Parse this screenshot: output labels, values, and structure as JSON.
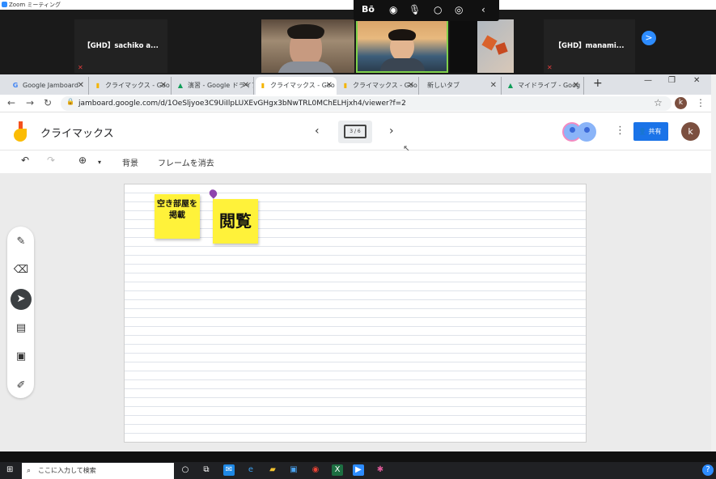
{
  "zoom": {
    "window_title": "Zoom ミーティング",
    "participants": [
      "【GHD】sachiko a...",
      "【GHD】manami..."
    ],
    "toolbar_icons": [
      "bo-logo-icon",
      "record-icon",
      "microphone-icon",
      "circle-icon",
      "audio-wave-icon",
      "chevron-left-icon"
    ],
    "next_label": ">"
  },
  "browser": {
    "tabs": [
      {
        "label": "Google Jamboard",
        "icon": "google-icon"
      },
      {
        "label": "クライマックス - Goo",
        "icon": "jamboard-icon"
      },
      {
        "label": "演習 - Google ドライブ",
        "icon": "drive-icon"
      },
      {
        "label": "クライマックス - Goo",
        "icon": "jamboard-icon",
        "active": true
      },
      {
        "label": "クライマックス - Goo",
        "icon": "jamboard-icon"
      },
      {
        "label": "新しいタブ",
        "icon": ""
      },
      {
        "label": "マイドライブ - Goog",
        "icon": "drive-icon"
      }
    ],
    "new_tab": "+",
    "url": "jamboard.google.com/d/1OeSljyoe3C9UiIlpLUXEvGHgx3bNwTRL0MChELHjxh4/viewer?f=2",
    "profile_initial": "k"
  },
  "jamboard": {
    "title": "クライマックス",
    "frame_indicator": "3 / 6",
    "share_label": "共有",
    "profile_initial": "k",
    "toolbar": {
      "background_label": "背景",
      "clear_frame_label": "フレームを消去"
    },
    "stickies": [
      {
        "text": "空き部屋を掲載",
        "color": "#fff23a"
      },
      {
        "text": "閲覧",
        "color": "#fff23a"
      }
    ],
    "tools": [
      "pen-icon",
      "eraser-icon",
      "select-icon",
      "sticky-note-icon",
      "image-icon",
      "laser-icon"
    ]
  },
  "taskbar": {
    "search_placeholder": "ここに入力して検索"
  }
}
